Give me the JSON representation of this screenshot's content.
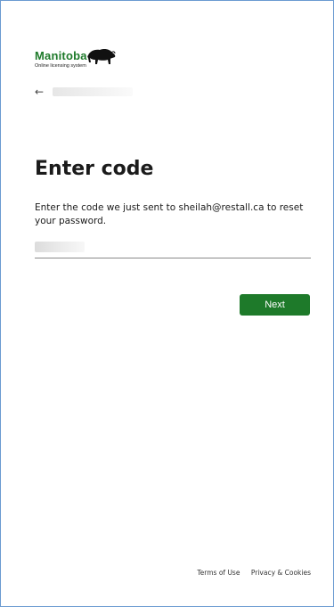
{
  "brand": {
    "name": "Manitoba",
    "tagline": "Online licensing system",
    "color": "#1e7a2a",
    "icon": "bison-icon"
  },
  "back": {
    "icon": "back-arrow-icon",
    "arrow": "←"
  },
  "main": {
    "title": "Enter code",
    "description": "Enter the code we just sent to sheilah@restall.ca to reset your password.",
    "code_value": ""
  },
  "actions": {
    "next_label": "Next"
  },
  "footer": {
    "terms_label": "Terms of Use",
    "privacy_label": "Privacy & Cookies"
  }
}
